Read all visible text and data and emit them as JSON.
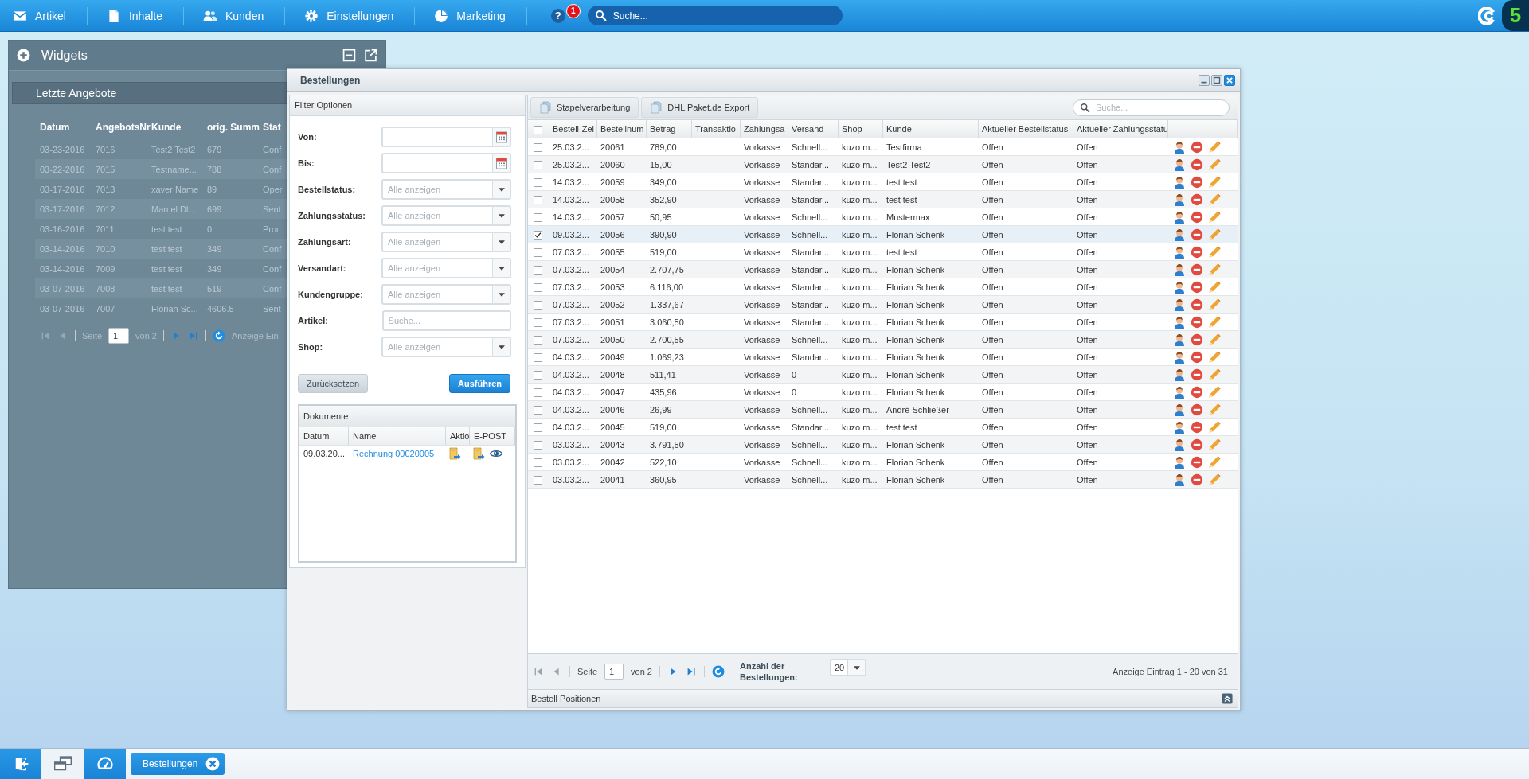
{
  "top_nav": {
    "items": [
      {
        "label": "Artikel",
        "kind": "articles"
      },
      {
        "label": "Inhalte",
        "kind": "content"
      },
      {
        "label": "Kunden",
        "kind": "customers"
      },
      {
        "label": "Einstellungen",
        "kind": "settings"
      },
      {
        "label": "Marketing",
        "kind": "marketing"
      }
    ],
    "help": {
      "label": "?",
      "badge": "1"
    },
    "search": {
      "placeholder": "Suche..."
    },
    "brand": "5"
  },
  "widgets": {
    "title": "Widgets",
    "widget": {
      "title": "Letzte Angebote",
      "columns": [
        "Datum",
        "AngebotsNr",
        "Kunde",
        "orig. Summ",
        "Stat"
      ],
      "rows": [
        [
          "03-23-2016",
          "7016",
          "Test2 Test2",
          "679",
          "Conf"
        ],
        [
          "03-22-2016",
          "7015",
          "Testname...",
          "788",
          "Conf"
        ],
        [
          "03-17-2016",
          "7013",
          "xaver Name",
          "89",
          "Oper"
        ],
        [
          "03-17-2016",
          "7012",
          "Marcel Dl...",
          "699",
          "Sent"
        ],
        [
          "03-16-2016",
          "7011",
          "test test",
          "0",
          "Proc"
        ],
        [
          "03-14-2016",
          "7010",
          "test test",
          "349",
          "Conf"
        ],
        [
          "03-14-2016",
          "7009",
          "test test",
          "349",
          "Conf"
        ],
        [
          "03-07-2016",
          "7008",
          "test test",
          "519",
          "Conf"
        ],
        [
          "03-07-2016",
          "7007",
          "Florian Sc...",
          "4606.5",
          "Sent"
        ]
      ],
      "pager": {
        "page_label": "Seite",
        "page": "1",
        "page_count": "von 2",
        "info": "Anzeige Ein"
      }
    }
  },
  "window": {
    "title": "Bestellungen",
    "filter": {
      "title": "Filter Optionen",
      "fields": [
        {
          "label": "Von:",
          "kind": "date"
        },
        {
          "label": "Bis:",
          "kind": "date"
        },
        {
          "label": "Bestellstatus:",
          "kind": "select",
          "placeholder": "Alle anzeigen"
        },
        {
          "label": "Zahlungsstatus:",
          "kind": "select",
          "placeholder": "Alle anzeigen"
        },
        {
          "label": "Zahlungsart:",
          "kind": "select",
          "placeholder": "Alle anzeigen"
        },
        {
          "label": "Versandart:",
          "kind": "select",
          "placeholder": "Alle anzeigen"
        },
        {
          "label": "Kundengruppe:",
          "kind": "select",
          "placeholder": "Alle anzeigen"
        },
        {
          "label": "Artikel:",
          "kind": "text",
          "placeholder": "Suche..."
        },
        {
          "label": "Shop:",
          "kind": "select",
          "placeholder": "Alle anzeigen"
        }
      ],
      "reset_button": "Zurücksetzen",
      "submit_button": "Ausführen"
    },
    "documents": {
      "title": "Dokumente",
      "columns": [
        "Datum",
        "Name",
        "Aktio",
        "E-POST"
      ],
      "rows": [
        {
          "date": "09.03.20...",
          "name": "Rechnung 00020005"
        }
      ]
    },
    "orders": {
      "select_all": false,
      "toolbar": [
        "Stapelverarbeitung",
        "DHL Paket.de Export"
      ],
      "search": {
        "placeholder": "Suche..."
      },
      "columns": [
        "Bestell-Zei",
        "Bestellnum",
        "Betrag",
        "Transaktio",
        "Zahlungsa",
        "Versand",
        "Shop",
        "Kunde",
        "Aktueller Bestellstatus",
        "Aktueller Zahlungsstatu"
      ],
      "rows": [
        {
          "selected": false,
          "date": "25.03.2...",
          "number": "20061",
          "amount": "789,00",
          "payment": "Vorkasse",
          "shipping": "Schnell...",
          "shop": "kuzo m...",
          "customer": "Testfirma",
          "order_status": "Offen",
          "payment_status": "Offen"
        },
        {
          "selected": false,
          "date": "25.03.2...",
          "number": "20060",
          "amount": "15,00",
          "payment": "Vorkasse",
          "shipping": "Standar...",
          "shop": "kuzo m...",
          "customer": "Test2 Test2",
          "order_status": "Offen",
          "payment_status": "Offen"
        },
        {
          "selected": false,
          "date": "14.03.2...",
          "number": "20059",
          "amount": "349,00",
          "payment": "Vorkasse",
          "shipping": "Standar...",
          "shop": "kuzo m...",
          "customer": "test test",
          "order_status": "Offen",
          "payment_status": "Offen"
        },
        {
          "selected": false,
          "date": "14.03.2...",
          "number": "20058",
          "amount": "352,90",
          "payment": "Vorkasse",
          "shipping": "Standar...",
          "shop": "kuzo m...",
          "customer": "test test",
          "order_status": "Offen",
          "payment_status": "Offen"
        },
        {
          "selected": false,
          "date": "14.03.2...",
          "number": "20057",
          "amount": "50,95",
          "payment": "Vorkasse",
          "shipping": "Schnell...",
          "shop": "kuzo m...",
          "customer": "Mustermax",
          "order_status": "Offen",
          "payment_status": "Offen"
        },
        {
          "selected": true,
          "date": "09.03.2...",
          "number": "20056",
          "amount": "390,90",
          "payment": "Vorkasse",
          "shipping": "Schnell...",
          "shop": "kuzo m...",
          "customer": "Florian Schenk",
          "order_status": "Offen",
          "payment_status": "Offen"
        },
        {
          "selected": false,
          "date": "07.03.2...",
          "number": "20055",
          "amount": "519,00",
          "payment": "Vorkasse",
          "shipping": "Standar...",
          "shop": "kuzo m...",
          "customer": "test test",
          "order_status": "Offen",
          "payment_status": "Offen"
        },
        {
          "selected": false,
          "date": "07.03.2...",
          "number": "20054",
          "amount": "2.707,75",
          "payment": "Vorkasse",
          "shipping": "Standar...",
          "shop": "kuzo m...",
          "customer": "Florian Schenk",
          "order_status": "Offen",
          "payment_status": "Offen"
        },
        {
          "selected": false,
          "date": "07.03.2...",
          "number": "20053",
          "amount": "6.116,00",
          "payment": "Vorkasse",
          "shipping": "Standar...",
          "shop": "kuzo m...",
          "customer": "Florian Schenk",
          "order_status": "Offen",
          "payment_status": "Offen"
        },
        {
          "selected": false,
          "date": "07.03.2...",
          "number": "20052",
          "amount": "1.337,67",
          "payment": "Vorkasse",
          "shipping": "Standar...",
          "shop": "kuzo m...",
          "customer": "Florian Schenk",
          "order_status": "Offen",
          "payment_status": "Offen"
        },
        {
          "selected": false,
          "date": "07.03.2...",
          "number": "20051",
          "amount": "3.060,50",
          "payment": "Vorkasse",
          "shipping": "Standar...",
          "shop": "kuzo m...",
          "customer": "Florian Schenk",
          "order_status": "Offen",
          "payment_status": "Offen"
        },
        {
          "selected": false,
          "date": "07.03.2...",
          "number": "20050",
          "amount": "2.700,55",
          "payment": "Vorkasse",
          "shipping": "Schnell...",
          "shop": "kuzo m...",
          "customer": "Florian Schenk",
          "order_status": "Offen",
          "payment_status": "Offen"
        },
        {
          "selected": false,
          "date": "04.03.2...",
          "number": "20049",
          "amount": "1.069,23",
          "payment": "Vorkasse",
          "shipping": "Standar...",
          "shop": "kuzo m...",
          "customer": "Florian Schenk",
          "order_status": "Offen",
          "payment_status": "Offen"
        },
        {
          "selected": false,
          "date": "04.03.2...",
          "number": "20048",
          "amount": "511,41",
          "payment": "Vorkasse",
          "shipping": "0",
          "shop": "kuzo m...",
          "customer": "Florian Schenk",
          "order_status": "Offen",
          "payment_status": "Offen"
        },
        {
          "selected": false,
          "date": "04.03.2...",
          "number": "20047",
          "amount": "435,96",
          "payment": "Vorkasse",
          "shipping": "0",
          "shop": "kuzo m...",
          "customer": "Florian Schenk",
          "order_status": "Offen",
          "payment_status": "Offen"
        },
        {
          "selected": false,
          "date": "04.03.2...",
          "number": "20046",
          "amount": "26,99",
          "payment": "Vorkasse",
          "shipping": "Schnell...",
          "shop": "kuzo m...",
          "customer": "André Schließer",
          "order_status": "Offen",
          "payment_status": "Offen"
        },
        {
          "selected": false,
          "date": "04.03.2...",
          "number": "20045",
          "amount": "519,00",
          "payment": "Vorkasse",
          "shipping": "Standar...",
          "shop": "kuzo m...",
          "customer": "test test",
          "order_status": "Offen",
          "payment_status": "Offen"
        },
        {
          "selected": false,
          "date": "03.03.2...",
          "number": "20043",
          "amount": "3.791,50",
          "payment": "Vorkasse",
          "shipping": "Schnell...",
          "shop": "kuzo m...",
          "customer": "Florian Schenk",
          "order_status": "Offen",
          "payment_status": "Offen"
        },
        {
          "selected": false,
          "date": "03.03.2...",
          "number": "20042",
          "amount": "522,10",
          "payment": "Vorkasse",
          "shipping": "Schnell...",
          "shop": "kuzo m...",
          "customer": "Florian Schenk",
          "order_status": "Offen",
          "payment_status": "Offen"
        },
        {
          "selected": false,
          "date": "03.03.2...",
          "number": "20041",
          "amount": "360,95",
          "payment": "Vorkasse",
          "shipping": "Schnell...",
          "shop": "kuzo m...",
          "customer": "Florian Schenk",
          "order_status": "Offen",
          "payment_status": "Offen"
        }
      ],
      "pager": {
        "page_label": "Seite",
        "page": "1",
        "page_count": "von 2",
        "page_size_label": "Anzahl der Bestellungen:",
        "page_size": "20",
        "info": "Anzeige Eintrag 1 - 20 von 31"
      }
    },
    "details_panel": {
      "title": "Bestell Positionen"
    }
  },
  "taskbar": {
    "tasks": [
      {
        "label": "Bestellungen"
      }
    ]
  }
}
